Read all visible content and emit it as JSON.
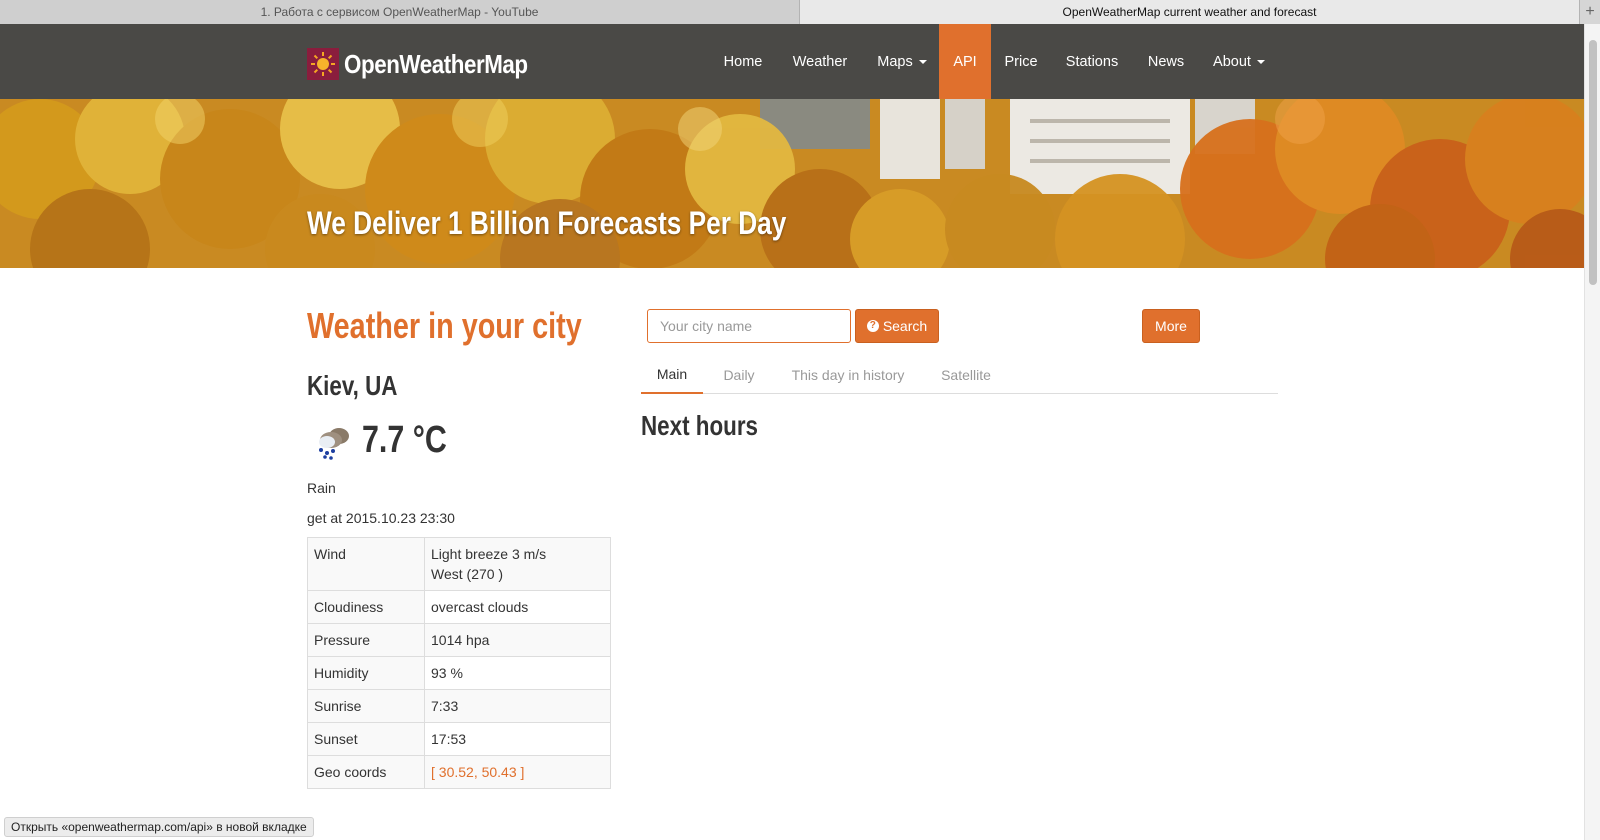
{
  "browser": {
    "tabs": [
      {
        "title": "1. Работа с сервисом OpenWeatherMap - YouTube"
      },
      {
        "title": "OpenWeatherMap current weather and forecast"
      }
    ],
    "new_tab_icon": "+"
  },
  "navbar": {
    "brand": "OpenWeatherMap",
    "logo_icon": "sun-icon",
    "items": [
      {
        "label": "Home"
      },
      {
        "label": "Weather"
      },
      {
        "label": "Maps"
      },
      {
        "label": "API"
      },
      {
        "label": "Price"
      },
      {
        "label": "Stations"
      },
      {
        "label": "News"
      },
      {
        "label": "About"
      }
    ],
    "active": "API",
    "accent_color": "#e0702d"
  },
  "hero": {
    "title": "We Deliver 1 Billion Forecasts Per Day"
  },
  "city_panel": {
    "heading": "Weather in your city",
    "city": "Kiev, UA",
    "weather_icon": "rain-cloud-icon",
    "temperature": "7.7 °C",
    "description": "Rain",
    "fetched": "get at 2015.10.23 23:30",
    "details": [
      {
        "key": "Wind",
        "value": "Light breeze 3 m/s",
        "value2": "West (270 )"
      },
      {
        "key": "Cloudiness",
        "value": "overcast clouds"
      },
      {
        "key": "Pressure",
        "value": "1014 hpa"
      },
      {
        "key": "Humidity",
        "value": "93 %"
      },
      {
        "key": "Sunrise",
        "value": "7:33"
      },
      {
        "key": "Sunset",
        "value": "17:53"
      },
      {
        "key": "Geo coords",
        "value": "[ 30.52, 50.43 ]"
      }
    ]
  },
  "search": {
    "placeholder": "Your city name",
    "button_label": "Search",
    "button_icon": "question-circle-icon",
    "more_label": "More"
  },
  "tabs": [
    {
      "label": "Main"
    },
    {
      "label": "Daily"
    },
    {
      "label": "This day in history"
    },
    {
      "label": "Satellite"
    }
  ],
  "active_tab": "Main",
  "section": {
    "title": "Next hours"
  },
  "statusbar": {
    "text": "Открыть «openweathermap.com/api» в новой вкладке"
  }
}
